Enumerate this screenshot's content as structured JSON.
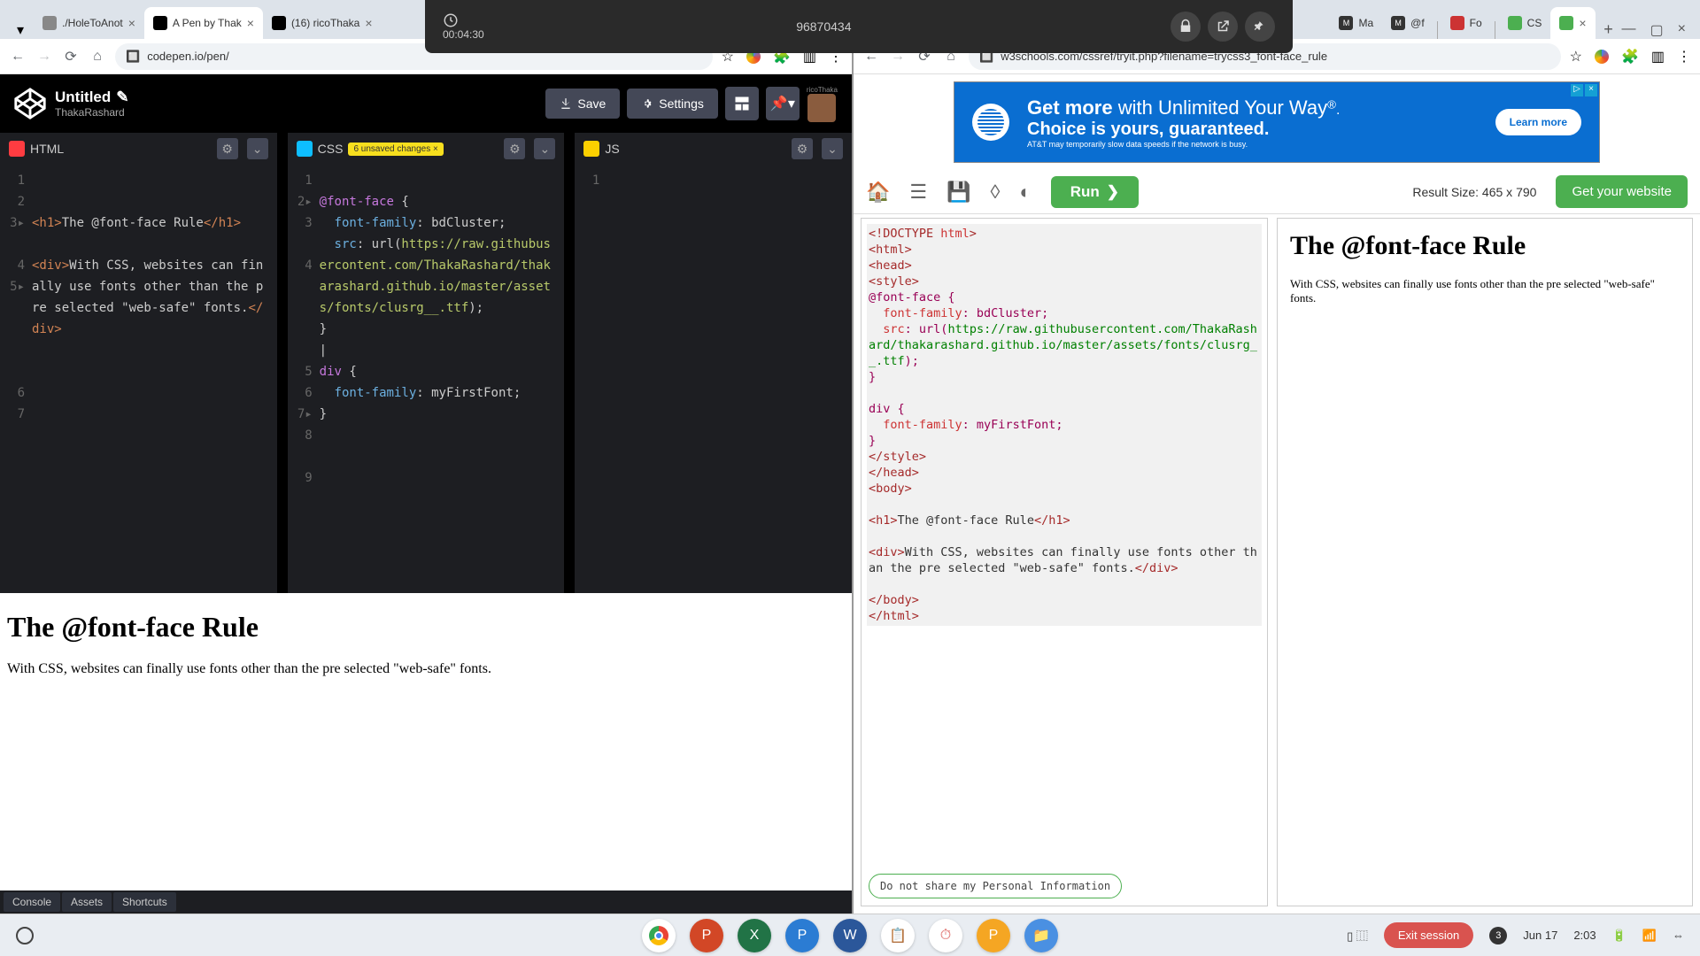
{
  "overlay": {
    "timer": "00:04:30",
    "session_id": "96870434"
  },
  "tabs_left": [
    {
      "label": "./HoleToAnot"
    },
    {
      "label": "A Pen by Thak",
      "active": true
    },
    {
      "label": "(16) ricoThaka"
    }
  ],
  "tabs_right": [
    {
      "label": "Ma"
    },
    {
      "label": "@f"
    },
    {
      "label": "Fo"
    },
    {
      "label": "CS"
    },
    {
      "label": "",
      "active": true
    }
  ],
  "url_left": "codepen.io/pen/",
  "url_right": "w3schools.com/cssref/tryit.php?filename=trycss3_font-face_rule",
  "codepen": {
    "title": "Untitled",
    "author": "ThakaRashard",
    "save": "Save",
    "settings": "Settings",
    "user_badge": "ricoThaka",
    "html_label": "HTML",
    "css_label": "CSS",
    "js_label": "JS",
    "unsaved": "6 unsaved changes",
    "bottom": {
      "console": "Console",
      "assets": "Assets",
      "shortcuts": "Shortcuts"
    },
    "preview_h1": "The @font-face Rule",
    "preview_body": "With CSS, websites can finally use fonts other than the pre selected \"web-safe\" fonts.",
    "html_lines": [
      "1",
      "2",
      "3",
      "",
      "4",
      "5",
      "",
      "",
      "",
      "",
      "6",
      "7"
    ],
    "css_lines": [
      "1",
      "2",
      "3",
      "",
      "4",
      "",
      "",
      "",
      "",
      "5",
      "6",
      "7",
      "8",
      "",
      "9"
    ]
  },
  "w3": {
    "ad_line1a": "Get more",
    "ad_line1b": " with Unlimited Your Way",
    "ad_line2": "Choice is yours, guaranteed.",
    "ad_fine": "AT&T may temporarily slow data speeds if the network is busy.",
    "ad_cta": "Learn more",
    "run": "Run",
    "result_size": "Result Size: 465 x 790",
    "get_site": "Get your website",
    "result_h1": "The @font-face Rule",
    "result_body": "With CSS, websites can finally use fonts other than the pre selected \"web-safe\" fonts.",
    "privacy": "Do not share my Personal Information"
  },
  "taskbar": {
    "exit": "Exit session",
    "count": "3",
    "date": "Jun 17",
    "time": "2:03"
  }
}
